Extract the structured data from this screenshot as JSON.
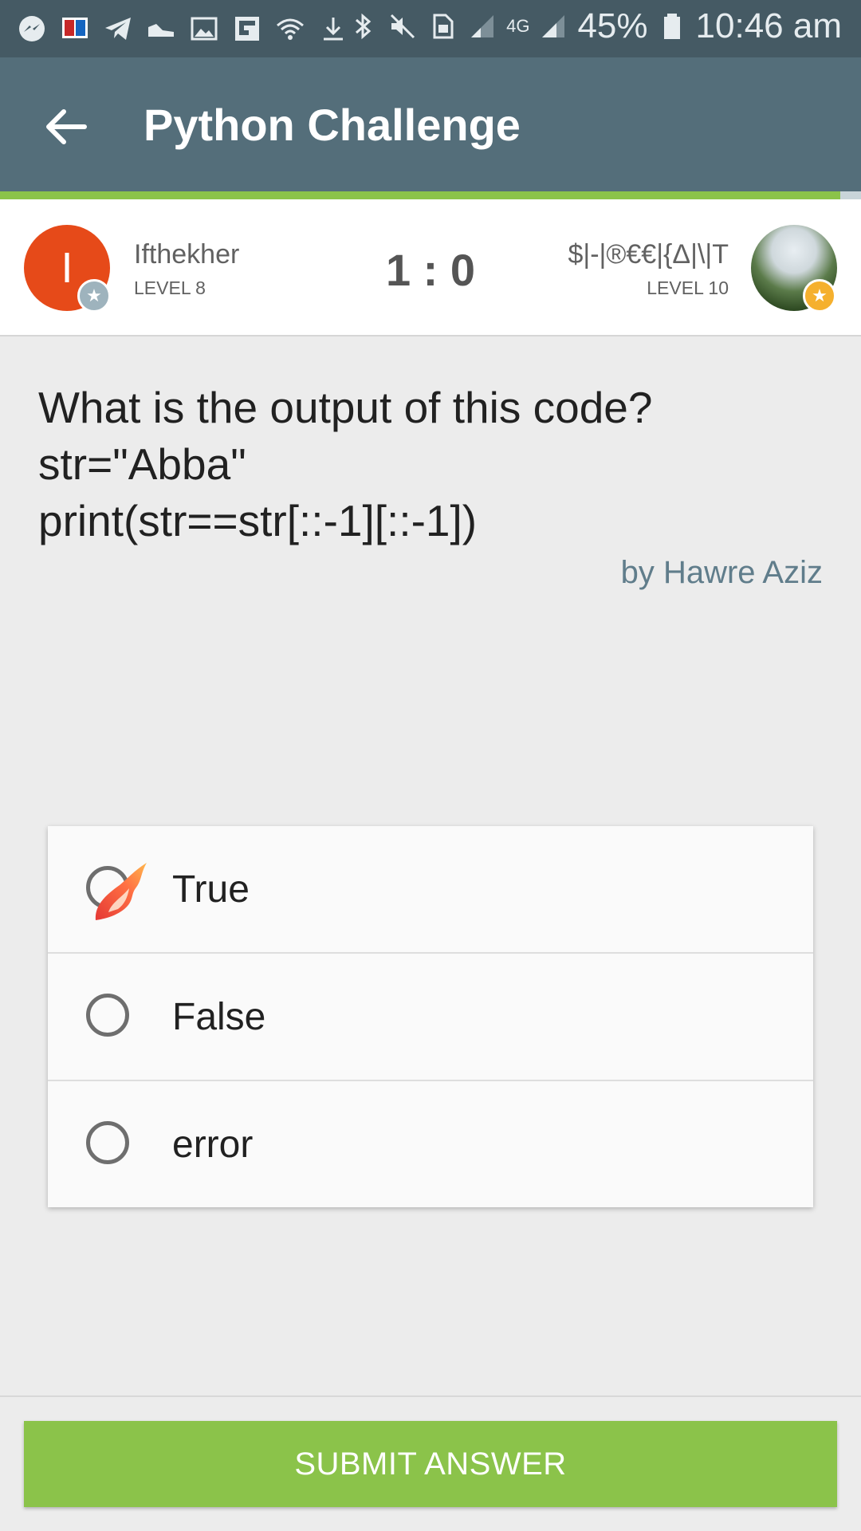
{
  "status_bar": {
    "battery": "45%",
    "time": "10:46 am",
    "network": "4G"
  },
  "app_bar": {
    "title": "Python Challenge"
  },
  "players": {
    "left": {
      "initial": "I",
      "name": "Ifthekher",
      "level": "LEVEL 8"
    },
    "right": {
      "name": "$|-|®€€|{Δ|\\|T",
      "level": "LEVEL 10"
    },
    "score": "1 : 0"
  },
  "question": {
    "lines": [
      "What is the output of this code?",
      "str=\"Abba\"",
      "print(str==str[::-1][::-1])"
    ],
    "author": "by Hawre Aziz"
  },
  "answers": [
    {
      "label": "True",
      "selected": true
    },
    {
      "label": "False",
      "selected": false
    },
    {
      "label": "error",
      "selected": false
    }
  ],
  "submit": {
    "label": "SUBMIT ANSWER"
  },
  "colors": {
    "status_bar": "#455a64",
    "app_bar": "#546e7a",
    "accent": "#8bc34a",
    "avatar_left": "#e64a19",
    "author": "#607d8b"
  }
}
